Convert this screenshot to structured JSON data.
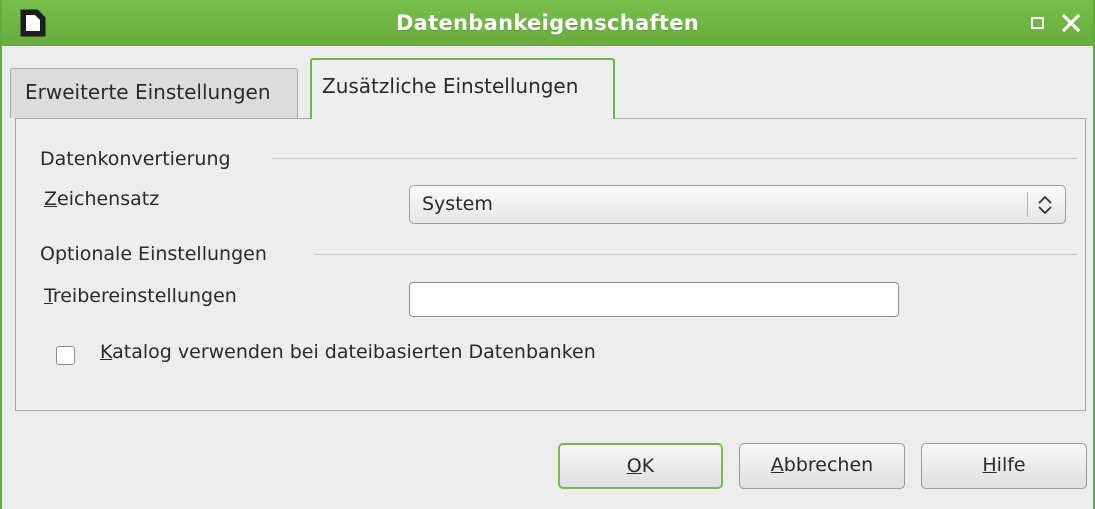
{
  "window": {
    "title": "Datenbankeigenschaften"
  },
  "tabs": [
    {
      "label": "Erweiterte Einstellungen",
      "selected": false
    },
    {
      "label": "Zusätzliche Einstellungen",
      "selected": true
    }
  ],
  "sections": {
    "data_conversion": "Datenkonvertierung",
    "optional_settings": "Optionale Einstellungen"
  },
  "fields": {
    "charset": {
      "label_mnemonic": "Z",
      "label_rest": "eichensatz",
      "value": "System"
    },
    "driver_settings": {
      "label_mnemonic": "T",
      "label_rest": "reibereinstellungen",
      "value": ""
    },
    "use_catalog": {
      "label_mnemonic": "K",
      "label_rest": "atalog verwenden bei dateibasierten Datenbanken",
      "checked": false
    }
  },
  "buttons": {
    "ok": {
      "mnemonic": "O",
      "rest": "K"
    },
    "cancel": {
      "mnemonic": "A",
      "rest": "bbrechen"
    },
    "help": {
      "mnemonic": "H",
      "rest": "ilfe"
    }
  },
  "icons": {
    "app": "document-icon",
    "maximize": "maximize-icon",
    "close": "close-icon",
    "combo": "updown-chevron-icon"
  },
  "colors": {
    "titlebar": "#6db543",
    "accent_border": "#71b64a",
    "title_text": "#ffffff"
  }
}
